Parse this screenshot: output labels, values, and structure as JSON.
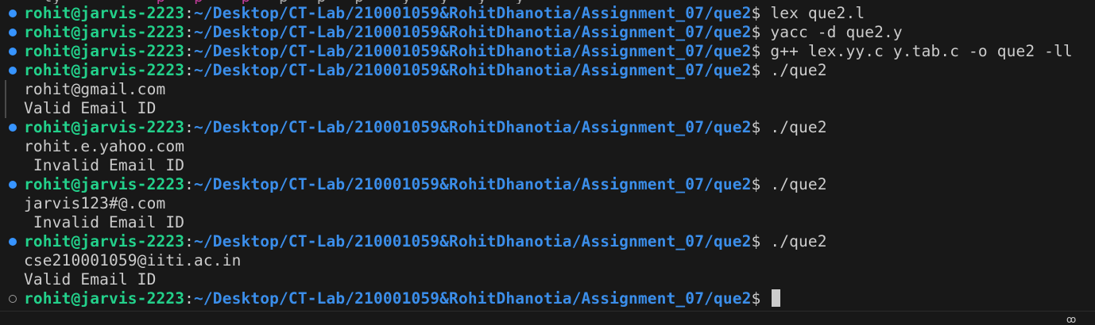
{
  "prompt": {
    "user_host": "rohit@jarvis-2223",
    "separator": ":",
    "path": "~/Desktop/CT-Lab/210001059&RohitDhanotia/Assignment_07/que2",
    "dollar": "$"
  },
  "entries": [
    {
      "status": "success",
      "command": "lex que2.l",
      "output": []
    },
    {
      "status": "success",
      "command": "yacc -d que2.y",
      "output": []
    },
    {
      "status": "success",
      "command": "g++ lex.yy.c y.tab.c -o que2 -ll",
      "output": []
    },
    {
      "status": "success",
      "command": "./que2",
      "output": [
        "rohit@gmail.com",
        "Valid Email ID"
      ]
    },
    {
      "status": "success",
      "command": "./que2",
      "output": [
        "rohit.e.yahoo.com",
        " Invalid Email ID"
      ]
    },
    {
      "status": "success",
      "command": "./que2",
      "output": [
        "jarvis123#@.com",
        " Invalid Email ID"
      ]
    },
    {
      "status": "success",
      "command": "./que2",
      "output": [
        "cse210001059@iiti.ac.in",
        "Valid Email ID"
      ]
    },
    {
      "status": "active",
      "command": "",
      "output": []
    }
  ],
  "colors": {
    "background": "#181818",
    "user_host": "#23d18b",
    "path": "#3b8eea",
    "text": "#cccccc",
    "decoration_dot": "#3794ff"
  },
  "icons": {
    "success_marker": "circle-filled-icon",
    "active_marker": "circle-outline-icon",
    "statusbar_icon": "copilot-icon"
  }
}
